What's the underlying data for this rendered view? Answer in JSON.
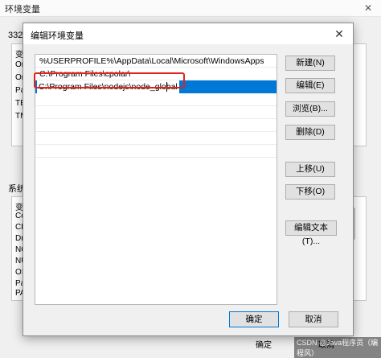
{
  "background_window": {
    "title": "环境变量",
    "user_vars_label": "3321",
    "user_vars_rows": [
      "变量",
      "On",
      "On",
      "Pa",
      "TEI",
      "TM"
    ],
    "sys_vars_label": "系统变",
    "sys_vars_rows": [
      "变量",
      "Co",
      "CP",
      "Dri",
      "NO",
      "NU",
      "OS",
      "Pat",
      "PA"
    ],
    "ok_label": "确定",
    "cancel_label": "取消",
    "watermark": "CSDN @Java程序员（编程风）"
  },
  "dialog": {
    "title": "编辑环境变量",
    "close_glyph": "✕",
    "paths": [
      "%USERPROFILE%\\AppData\\Local\\Microsoft\\WindowsApps",
      "C:\\Program Files\\cpolar\\",
      "C:\\Program Files\\nodejs\\node_global"
    ],
    "selected_index": 2,
    "buttons": {
      "new": "新建(N)",
      "edit": "编辑(E)",
      "browse": "浏览(B)...",
      "delete": "删除(D)",
      "move_up": "上移(U)",
      "move_down": "下移(O)",
      "edit_text": "编辑文本(T)..."
    },
    "ok_label": "确定",
    "cancel_label": "取消"
  },
  "colors": {
    "selection": "#0078d7",
    "highlight_box": "#e0231c"
  }
}
